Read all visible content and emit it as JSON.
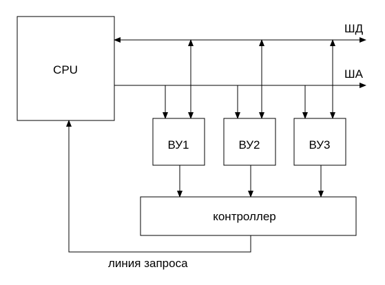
{
  "diagram": {
    "cpu": {
      "label": "CPU"
    },
    "buses": {
      "data_bus": {
        "label": "ШД"
      },
      "address_bus": {
        "label": "ША"
      }
    },
    "devices": [
      {
        "id": "vu1",
        "label": "ВУ1"
      },
      {
        "id": "vu2",
        "label": "ВУ2"
      },
      {
        "id": "vu3",
        "label": "ВУ3"
      }
    ],
    "controller": {
      "label": "контроллер"
    },
    "request_line": {
      "label": "линия запроса"
    },
    "colors": {
      "stroke": "#000000",
      "background": "#ffffff"
    }
  }
}
